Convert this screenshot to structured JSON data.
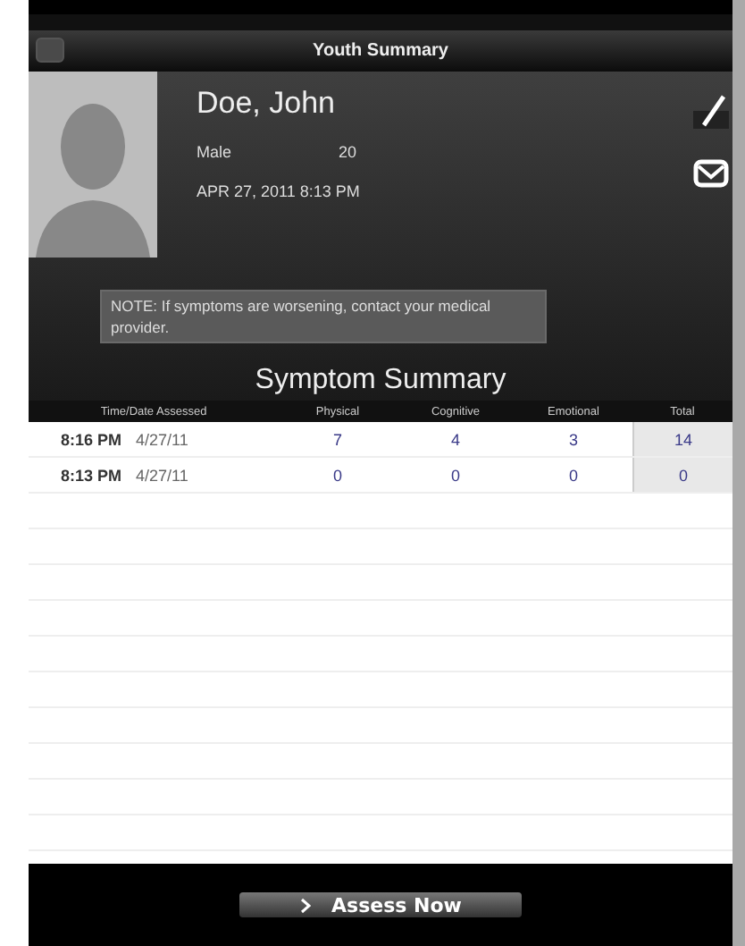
{
  "nav_bar": {
    "title": "Youth Summary"
  },
  "profile": {
    "name": "Doe, John",
    "gender": "Male",
    "age": "20",
    "date": "APR 27, 2011 8:13 PM"
  },
  "note": "NOTE: If symptoms are worsening, contact your medical provider.",
  "summary": {
    "title": "Symptom Summary",
    "columns": [
      "Time/Date Assessed",
      "Physical",
      "Cognitive",
      "Emotional",
      "Total"
    ],
    "rows": [
      {
        "time": "8:16 PM",
        "date": "4/27/11",
        "physical": "7",
        "cognitive": "4",
        "emotional": "3",
        "total": "14"
      },
      {
        "time": "8:13 PM",
        "date": "4/27/11",
        "physical": "0",
        "cognitive": "0",
        "emotional": "0",
        "total": "0"
      }
    ]
  },
  "action_button": {
    "label": "Assess Now"
  }
}
